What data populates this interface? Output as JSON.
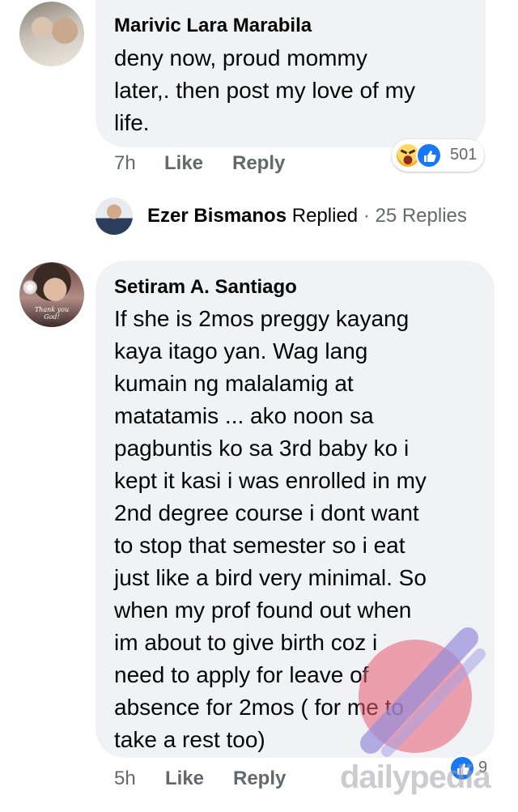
{
  "comments": [
    {
      "author": "Marivic Lara Marabila",
      "lines": [
        "deny now, proud mommy",
        "later,. then post my love of my",
        "life."
      ],
      "time": "7h",
      "like_label": "Like",
      "reply_label": "Reply",
      "reactions": [
        "haha",
        "like"
      ],
      "reaction_count": "501"
    },
    {
      "author": "Setiram A. Santiago",
      "avatar_caption": "Thank you God!",
      "lines": [
        "If she is 2mos preggy kayang",
        "kaya itago yan. Wag lang",
        "kumain ng malalamig at",
        "matatamis ... ako noon sa",
        "pagbuntis ko sa 3rd baby ko i",
        "kept it kasi i was enrolled in my",
        "2nd degree course i dont want",
        "to stop that semester so i eat",
        "just like a bird very minimal. So",
        "when my prof found out when",
        "im about to give birth coz i",
        "need to apply for leave of",
        "absence for 2mos ( for me to",
        "take a rest too)"
      ],
      "time": "5h",
      "like_label": "Like",
      "reply_label": "Reply",
      "reactions": [
        "like"
      ],
      "reaction_count": "9"
    }
  ],
  "replies_preview": {
    "name": "Ezer Bismanos",
    "action": "Replied",
    "separator": "·",
    "count_label": "25 Replies"
  },
  "watermark": "dailypedia",
  "colors": {
    "bubble": "#f0f2f5",
    "meta": "#65676b",
    "like_blue": "#1877f2"
  }
}
